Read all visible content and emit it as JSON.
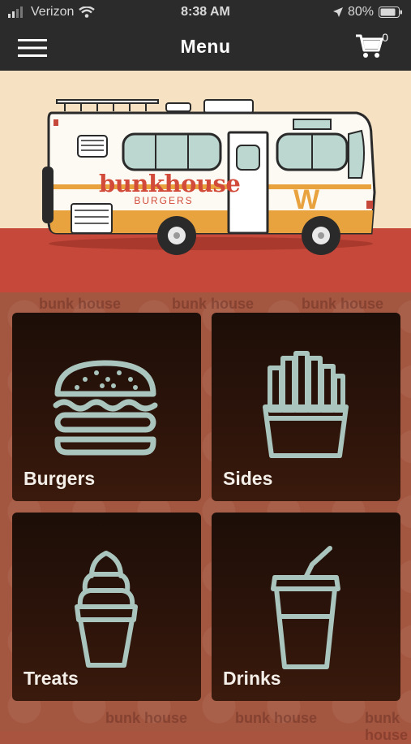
{
  "status_bar": {
    "carrier": "Verizon",
    "time": "8:38 AM",
    "battery": "80%"
  },
  "nav": {
    "title": "Menu",
    "cart_count": "0"
  },
  "hero": {
    "brand_main": "bunkhouse",
    "brand_sub": "BURGERS"
  },
  "categories": [
    {
      "label": "Burgers",
      "icon": "burger-icon"
    },
    {
      "label": "Sides",
      "icon": "fries-icon"
    },
    {
      "label": "Treats",
      "icon": "ice-cream-icon"
    },
    {
      "label": "Drinks",
      "icon": "drink-cup-icon"
    }
  ],
  "watermark_text": "bunk house",
  "colors": {
    "bar": "#2b2b2b",
    "hero_bg": "#f6e2c2",
    "ground": "#c5483a",
    "grid_bg": "#a35640",
    "tile": "#2d140a",
    "icon": "#a9c5bd",
    "brand_red": "#d24b3a",
    "brand_orange": "#e8a23e"
  }
}
